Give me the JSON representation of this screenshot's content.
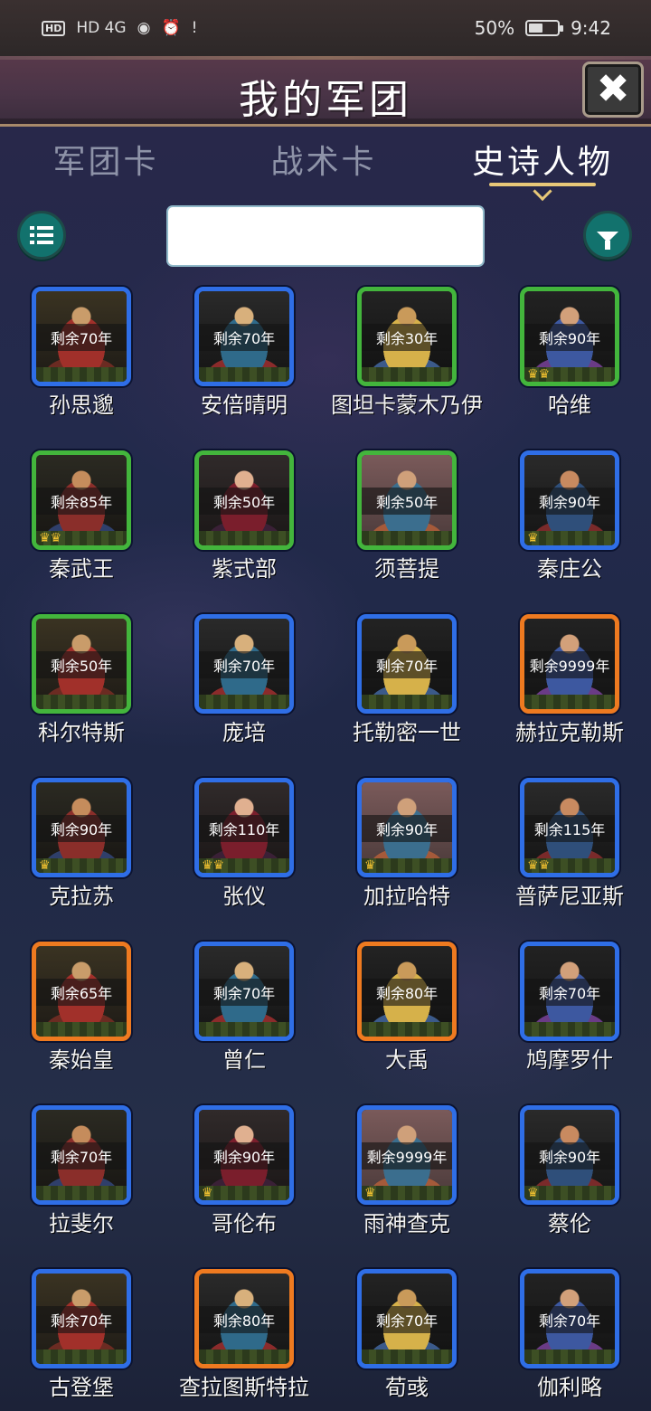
{
  "status_bar": {
    "network": "HD 4G",
    "battery": "50%",
    "battery_level": 0.5,
    "time": "9:42"
  },
  "header": {
    "title": "我的军团",
    "close_icon": "close-icon"
  },
  "tabs": [
    {
      "label": "军团卡",
      "active": false
    },
    {
      "label": "战术卡",
      "active": false
    },
    {
      "label": "史诗人物",
      "active": true
    }
  ],
  "toolbar": {
    "list_icon": "list-icon",
    "filter_icon": "filter-icon",
    "search_value": "",
    "search_placeholder": ""
  },
  "colors": {
    "blue_frame": "#2f6ee6",
    "green_frame": "#43b53c",
    "orange_frame": "#ee7a20",
    "teal_button": "#12726d",
    "tab_underline": "#e8c878"
  },
  "cards": [
    {
      "name": "孙思邈",
      "remaining": "剩余70年",
      "frame": "blue",
      "crowns": 0
    },
    {
      "name": "安倍晴明",
      "remaining": "剩余70年",
      "frame": "blue",
      "crowns": 0
    },
    {
      "name": "图坦卡蒙木乃伊",
      "remaining": "剩余30年",
      "frame": "green",
      "crowns": 0
    },
    {
      "name": "哈维",
      "remaining": "剩余90年",
      "frame": "green",
      "crowns": 2
    },
    {
      "name": "秦武王",
      "remaining": "剩余85年",
      "frame": "green",
      "crowns": 2
    },
    {
      "name": "紫式部",
      "remaining": "剩余50年",
      "frame": "green",
      "crowns": 0
    },
    {
      "name": "须菩提",
      "remaining": "剩余50年",
      "frame": "green",
      "crowns": 0
    },
    {
      "name": "秦庄公",
      "remaining": "剩余90年",
      "frame": "blue",
      "crowns": 1
    },
    {
      "name": "科尔特斯",
      "remaining": "剩余50年",
      "frame": "green",
      "crowns": 0
    },
    {
      "name": "庞培",
      "remaining": "剩余70年",
      "frame": "blue",
      "crowns": 0
    },
    {
      "name": "托勒密一世",
      "remaining": "剩余70年",
      "frame": "blue",
      "crowns": 0
    },
    {
      "name": "赫拉克勒斯",
      "remaining": "剩余9999年",
      "frame": "orange",
      "crowns": 0
    },
    {
      "name": "克拉苏",
      "remaining": "剩余90年",
      "frame": "blue",
      "crowns": 1
    },
    {
      "name": "张仪",
      "remaining": "剩余110年",
      "frame": "blue",
      "crowns": 2
    },
    {
      "name": "加拉哈特",
      "remaining": "剩余90年",
      "frame": "blue",
      "crowns": 1
    },
    {
      "name": "普萨尼亚斯",
      "remaining": "剩余115年",
      "frame": "blue",
      "crowns": 2
    },
    {
      "name": "秦始皇",
      "remaining": "剩余65年",
      "frame": "orange",
      "crowns": 0
    },
    {
      "name": "曾仁",
      "remaining": "剩余70年",
      "frame": "blue",
      "crowns": 0
    },
    {
      "name": "大禹",
      "remaining": "剩余80年",
      "frame": "orange",
      "crowns": 0
    },
    {
      "name": "鸠摩罗什",
      "remaining": "剩余70年",
      "frame": "blue",
      "crowns": 0
    },
    {
      "name": "拉斐尔",
      "remaining": "剩余70年",
      "frame": "blue",
      "crowns": 0
    },
    {
      "name": "哥伦布",
      "remaining": "剩余90年",
      "frame": "blue",
      "crowns": 1
    },
    {
      "name": "雨神查克",
      "remaining": "剩余9999年",
      "frame": "blue",
      "crowns": 1
    },
    {
      "name": "蔡伦",
      "remaining": "剩余90年",
      "frame": "blue",
      "crowns": 1
    },
    {
      "name": "古登堡",
      "remaining": "剩余70年",
      "frame": "blue",
      "crowns": 0
    },
    {
      "name": "查拉图斯特拉",
      "remaining": "剩余80年",
      "frame": "orange",
      "crowns": 0
    },
    {
      "name": "荀彧",
      "remaining": "剩余70年",
      "frame": "blue",
      "crowns": 0
    },
    {
      "name": "伽利略",
      "remaining": "剩余70年",
      "frame": "blue",
      "crowns": 0
    }
  ]
}
